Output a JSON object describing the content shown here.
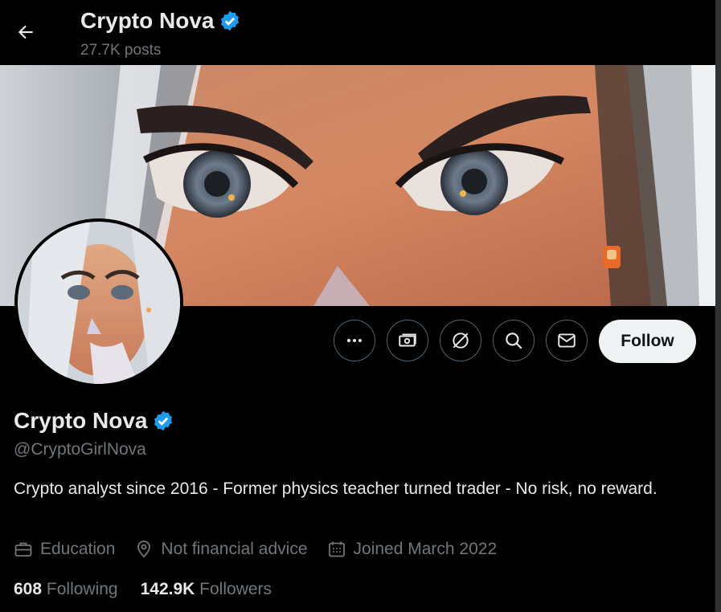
{
  "header": {
    "title": "Crypto Nova",
    "posts_count": "27.7K posts"
  },
  "actions": {
    "follow_label": "Follow"
  },
  "profile": {
    "name": "Crypto Nova",
    "handle": "@CryptoGirlNova",
    "bio": "Crypto analyst since 2016 - Former physics teacher turned trader - No risk, no reward.",
    "category": "Education",
    "location": "Not financial advice",
    "joined": "Joined March 2022"
  },
  "stats": {
    "following_count": "608",
    "following_label": "Following",
    "followers_count": "142.9K",
    "followers_label": "Followers"
  },
  "icons": {
    "back": "arrow-left-icon",
    "verified": "verified-badge-icon",
    "more": "more-horizontal-icon",
    "subscribe": "money-icon",
    "grok": "grok-icon",
    "search": "search-icon",
    "message": "mail-icon",
    "category": "briefcase-icon",
    "location": "location-pin-icon",
    "joined": "calendar-icon"
  },
  "colors": {
    "background": "#000000",
    "verified": "#1d9bf0",
    "muted_text": "#71767b",
    "follow_button_bg": "#eff3f4"
  }
}
